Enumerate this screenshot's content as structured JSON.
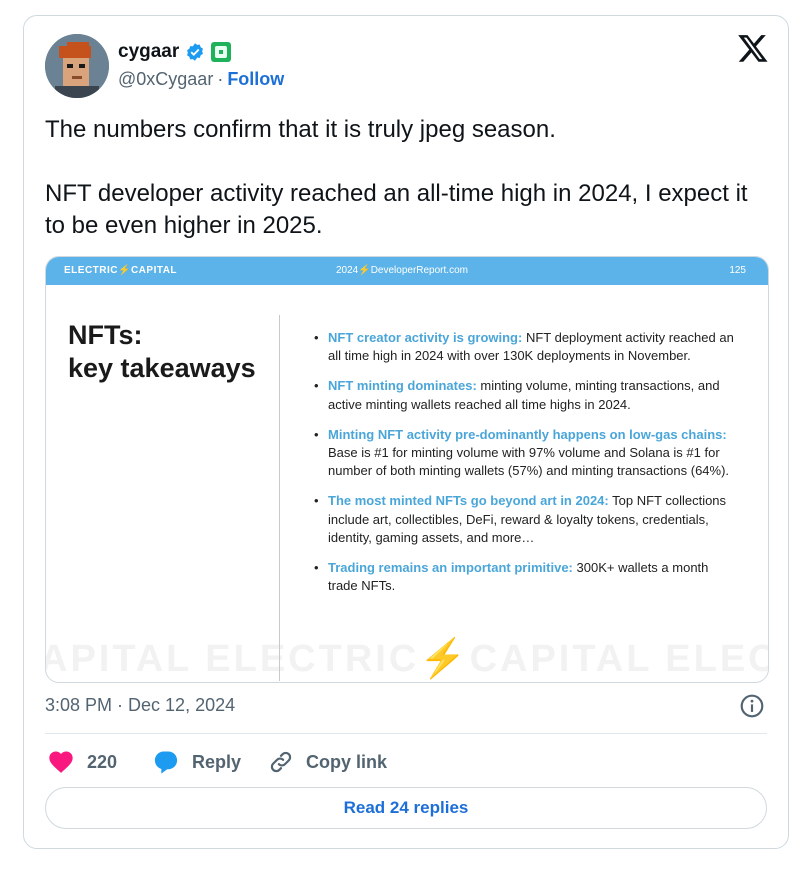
{
  "author": {
    "display_name": "cygaar",
    "handle": "@0xCygaar",
    "separator": "·",
    "follow_label": "Follow"
  },
  "tweet": {
    "paragraphs": [
      "The numbers confirm that it is truly jpeg season.",
      "NFT developer activity reached an all-time high in 2024, I expect it to be even higher in 2025."
    ],
    "timestamp": "3:08 PM · Dec 12, 2024"
  },
  "slide": {
    "header_left": "ELECTRIC⚡CAPITAL",
    "header_center": "2024⚡DeveloperReport.com",
    "header_right": "125",
    "title_line1": "NFTs:",
    "title_line2": "key takeaways",
    "bullets": [
      {
        "highlight": "NFT creator activity is growing:",
        "text": " NFT deployment activity reached an all time high in 2024 with over 130K deployments in November."
      },
      {
        "highlight": "NFT minting dominates:",
        "text": " minting volume, minting transactions, and active minting wallets reached all time highs in 2024."
      },
      {
        "highlight": "Minting NFT activity pre-dominantly happens on low-gas chains:",
        "text": " Base is #1 for minting volume with 97% volume and Solana is #1 for number of both minting wallets (57%) and minting transactions (64%)."
      },
      {
        "highlight": "The most minted NFTs go beyond art in 2024:",
        "text": " Top NFT collections include art, collectibles, DeFi, reward & loyalty tokens, credentials, identity, gaming assets, and more…"
      },
      {
        "highlight": "Trading remains an important primitive:",
        "text": " 300K+ wallets a month trade NFTs."
      }
    ],
    "watermark": "APITAL  ELECTRIC⚡CAPITAL  ELECT"
  },
  "actions": {
    "like_count": "220",
    "reply_label": "Reply",
    "copy_label": "Copy link"
  },
  "read_replies_label": "Read 24 replies",
  "colors": {
    "accent": "#1d6fd8",
    "like": "#f91880",
    "reply": "#1d9bf0",
    "slide_header": "#5bb3ea",
    "slide_highlight": "#4aa6d9"
  },
  "icons": [
    "verified-badge-icon",
    "affiliate-badge-icon",
    "x-logo-icon",
    "info-icon",
    "heart-icon",
    "reply-bubble-icon",
    "link-icon"
  ]
}
